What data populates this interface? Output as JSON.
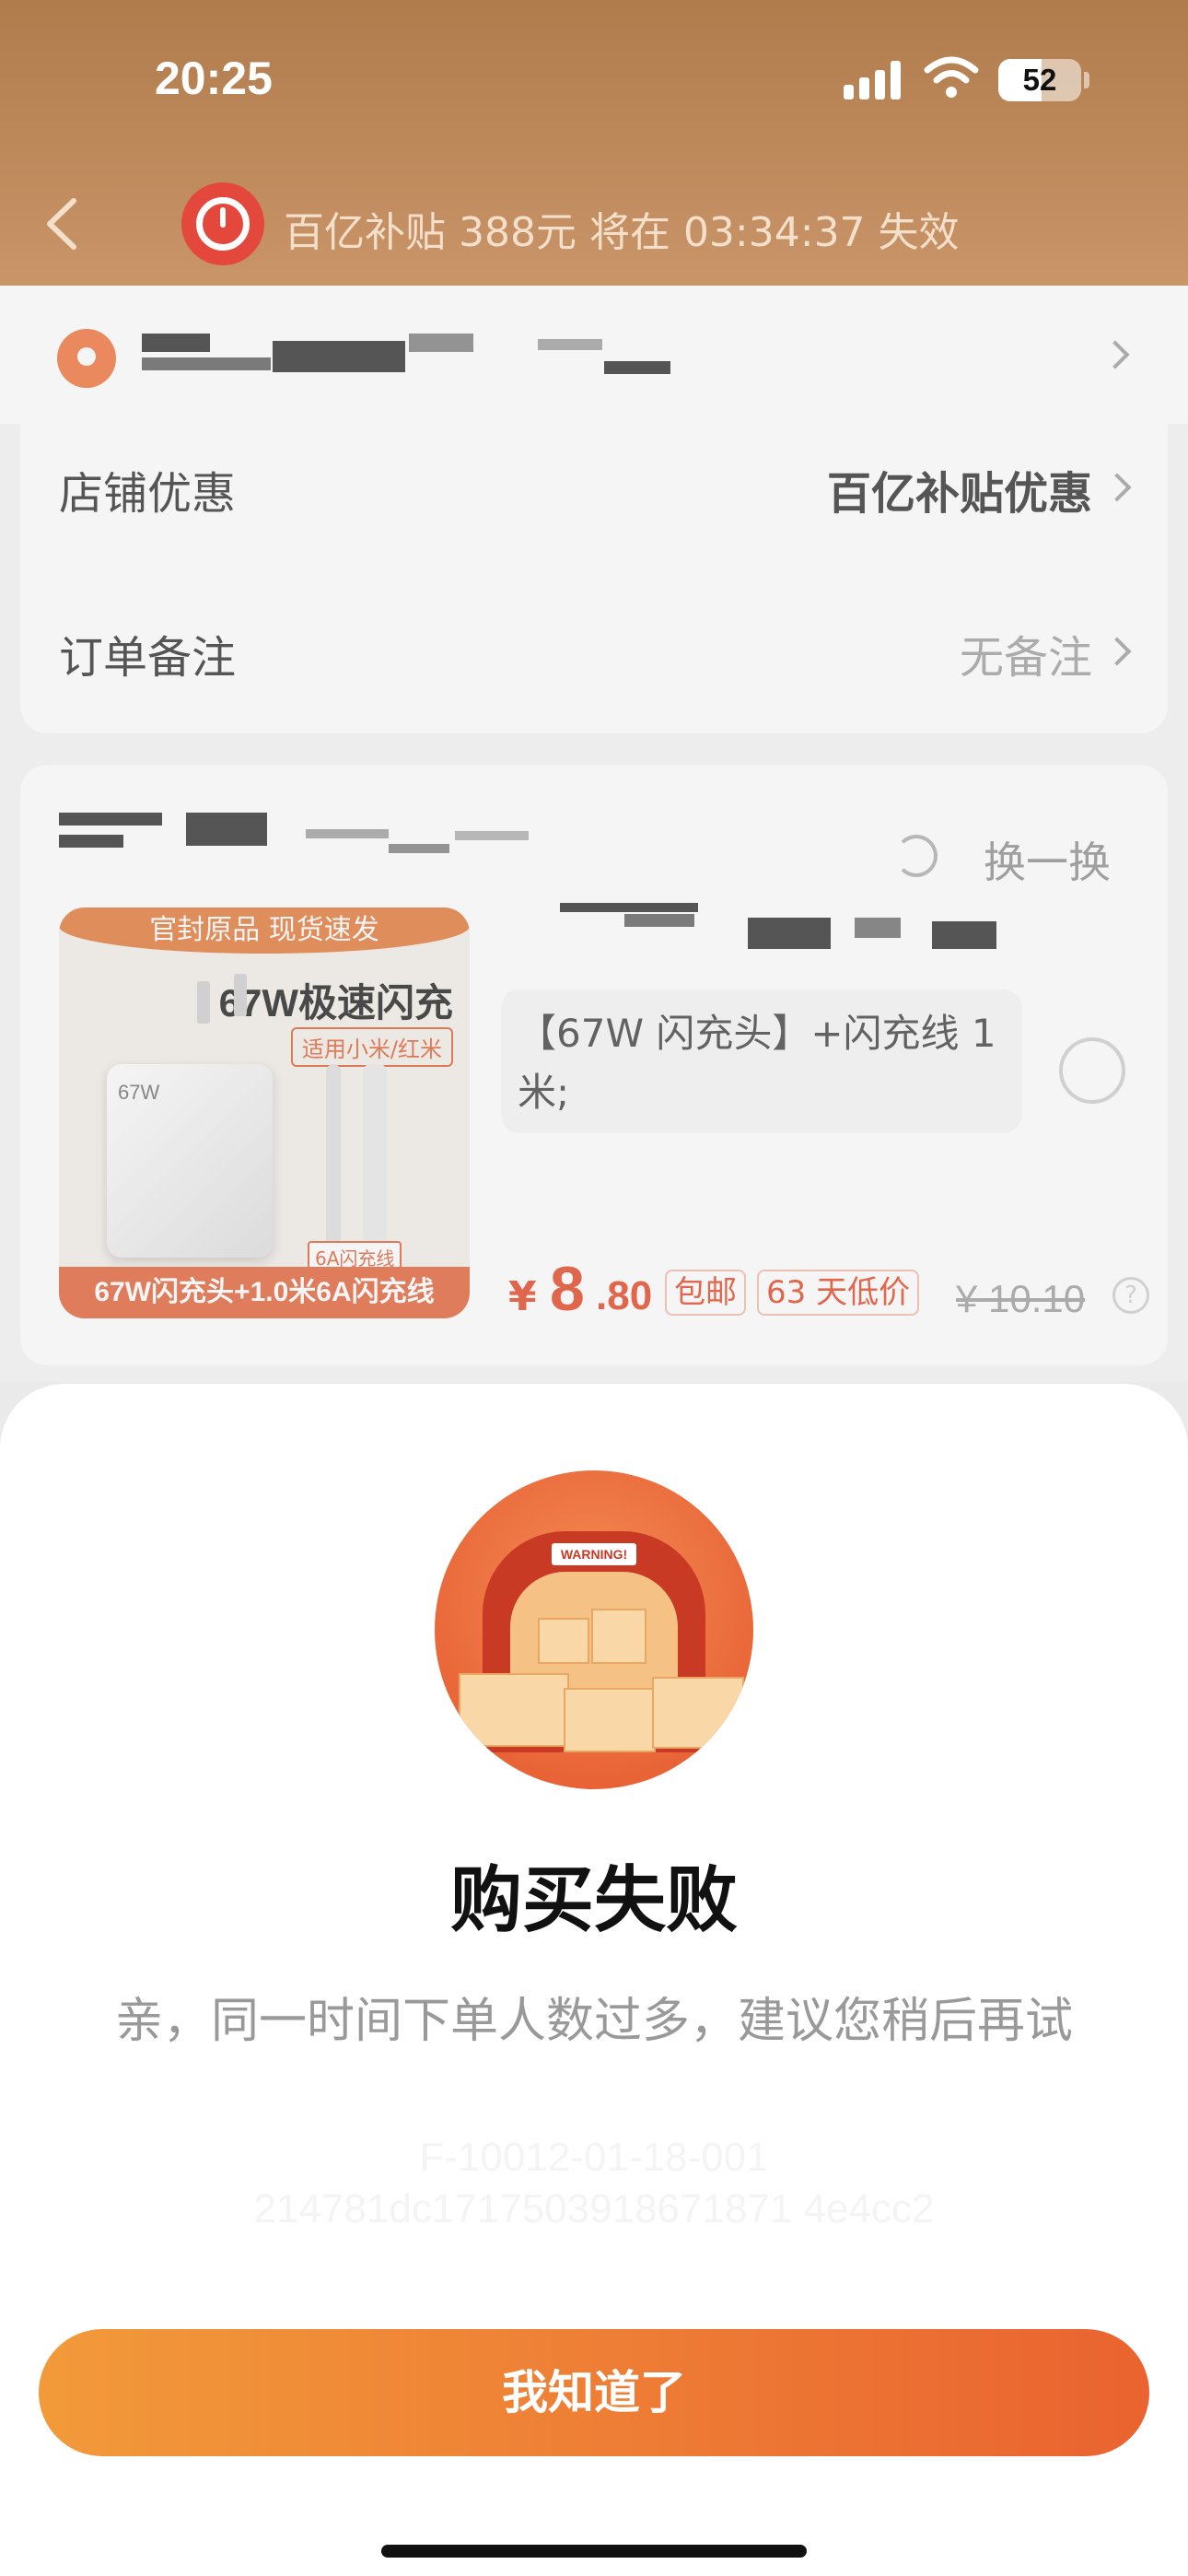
{
  "status_bar": {
    "time": "20:25",
    "battery": "52",
    "battery_level": 0.52
  },
  "header": {
    "banner": "百亿补贴 388元 将在 03:34:37 失效"
  },
  "order": {
    "store_discount_label": "店铺优惠",
    "store_discount_value": "百亿补贴优惠",
    "note_label": "订单备注",
    "note_value": "无备注"
  },
  "product": {
    "swap_label": "换一换",
    "image": {
      "top_banner": "官封原品  现货速发",
      "title": "67W极速闪充",
      "tag": "适用小米/红米",
      "charger_label": "67W",
      "cable_tag": "6A闪充线",
      "bottom_banner": "67W闪充头+1.0米6A闪充线"
    },
    "spec": "【67W 闪充头】+闪充线 1 米;",
    "price_symbol": "¥",
    "price_int": "8",
    "price_dec": ".80",
    "badge_shipping": "包邮",
    "badge_lowprice": "63 天低价",
    "original_price": "¥ 10.10",
    "help": "?"
  },
  "sheet": {
    "illustration_text": "WARNING!",
    "title": "购买失败",
    "message": "亲，同一时间下单人数过多，建议您稍后再试",
    "error_code_line1": "F-10012-01-18-001",
    "error_code_line2": "214781dc1717503918671871 4e4cc2",
    "button": "我知道了"
  },
  "colors": {
    "accent": "#ea6330",
    "header": "#b07c4c",
    "price": "#e33a16"
  }
}
